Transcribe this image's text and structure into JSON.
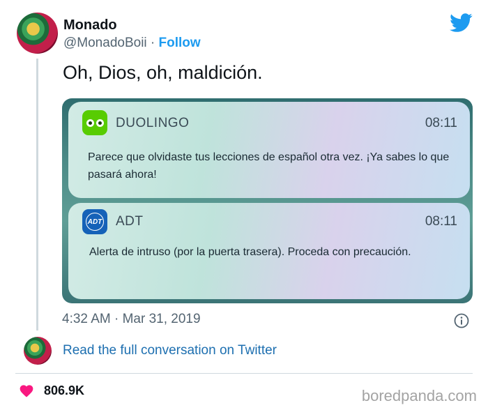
{
  "author": {
    "name": "Monado",
    "handle": "@MonadoBoii",
    "separator": " · ",
    "follow_label": "Follow"
  },
  "tweet": {
    "text": "Oh, Dios, oh, maldición."
  },
  "notifications": [
    {
      "app_name": "DUOLINGO",
      "time": "08:11",
      "body": "Parece que olvidaste tus lecciones de español otra vez. ¡Ya sabes lo que pasará ahora!",
      "icon": "duolingo-owl-icon",
      "icon_color": "#58cc02"
    },
    {
      "app_name": "ADT",
      "time": "08:11",
      "body": "Alerta de intruso (por la puerta trasera). Proceda con precaución.",
      "icon": "adt-logo-icon",
      "icon_color": "#1562b8",
      "icon_text": "ADT"
    }
  ],
  "meta": {
    "timestamp": "4:32 AM · Mar 31, 2019"
  },
  "conversation_link": "Read the full conversation on Twitter",
  "likes": {
    "count": "806.9K"
  },
  "watermark": "boredpanda.com",
  "colors": {
    "twitter_blue": "#1d9bf0",
    "like_red": "#f91880",
    "text_primary": "#0f1419",
    "text_secondary": "#536471"
  }
}
